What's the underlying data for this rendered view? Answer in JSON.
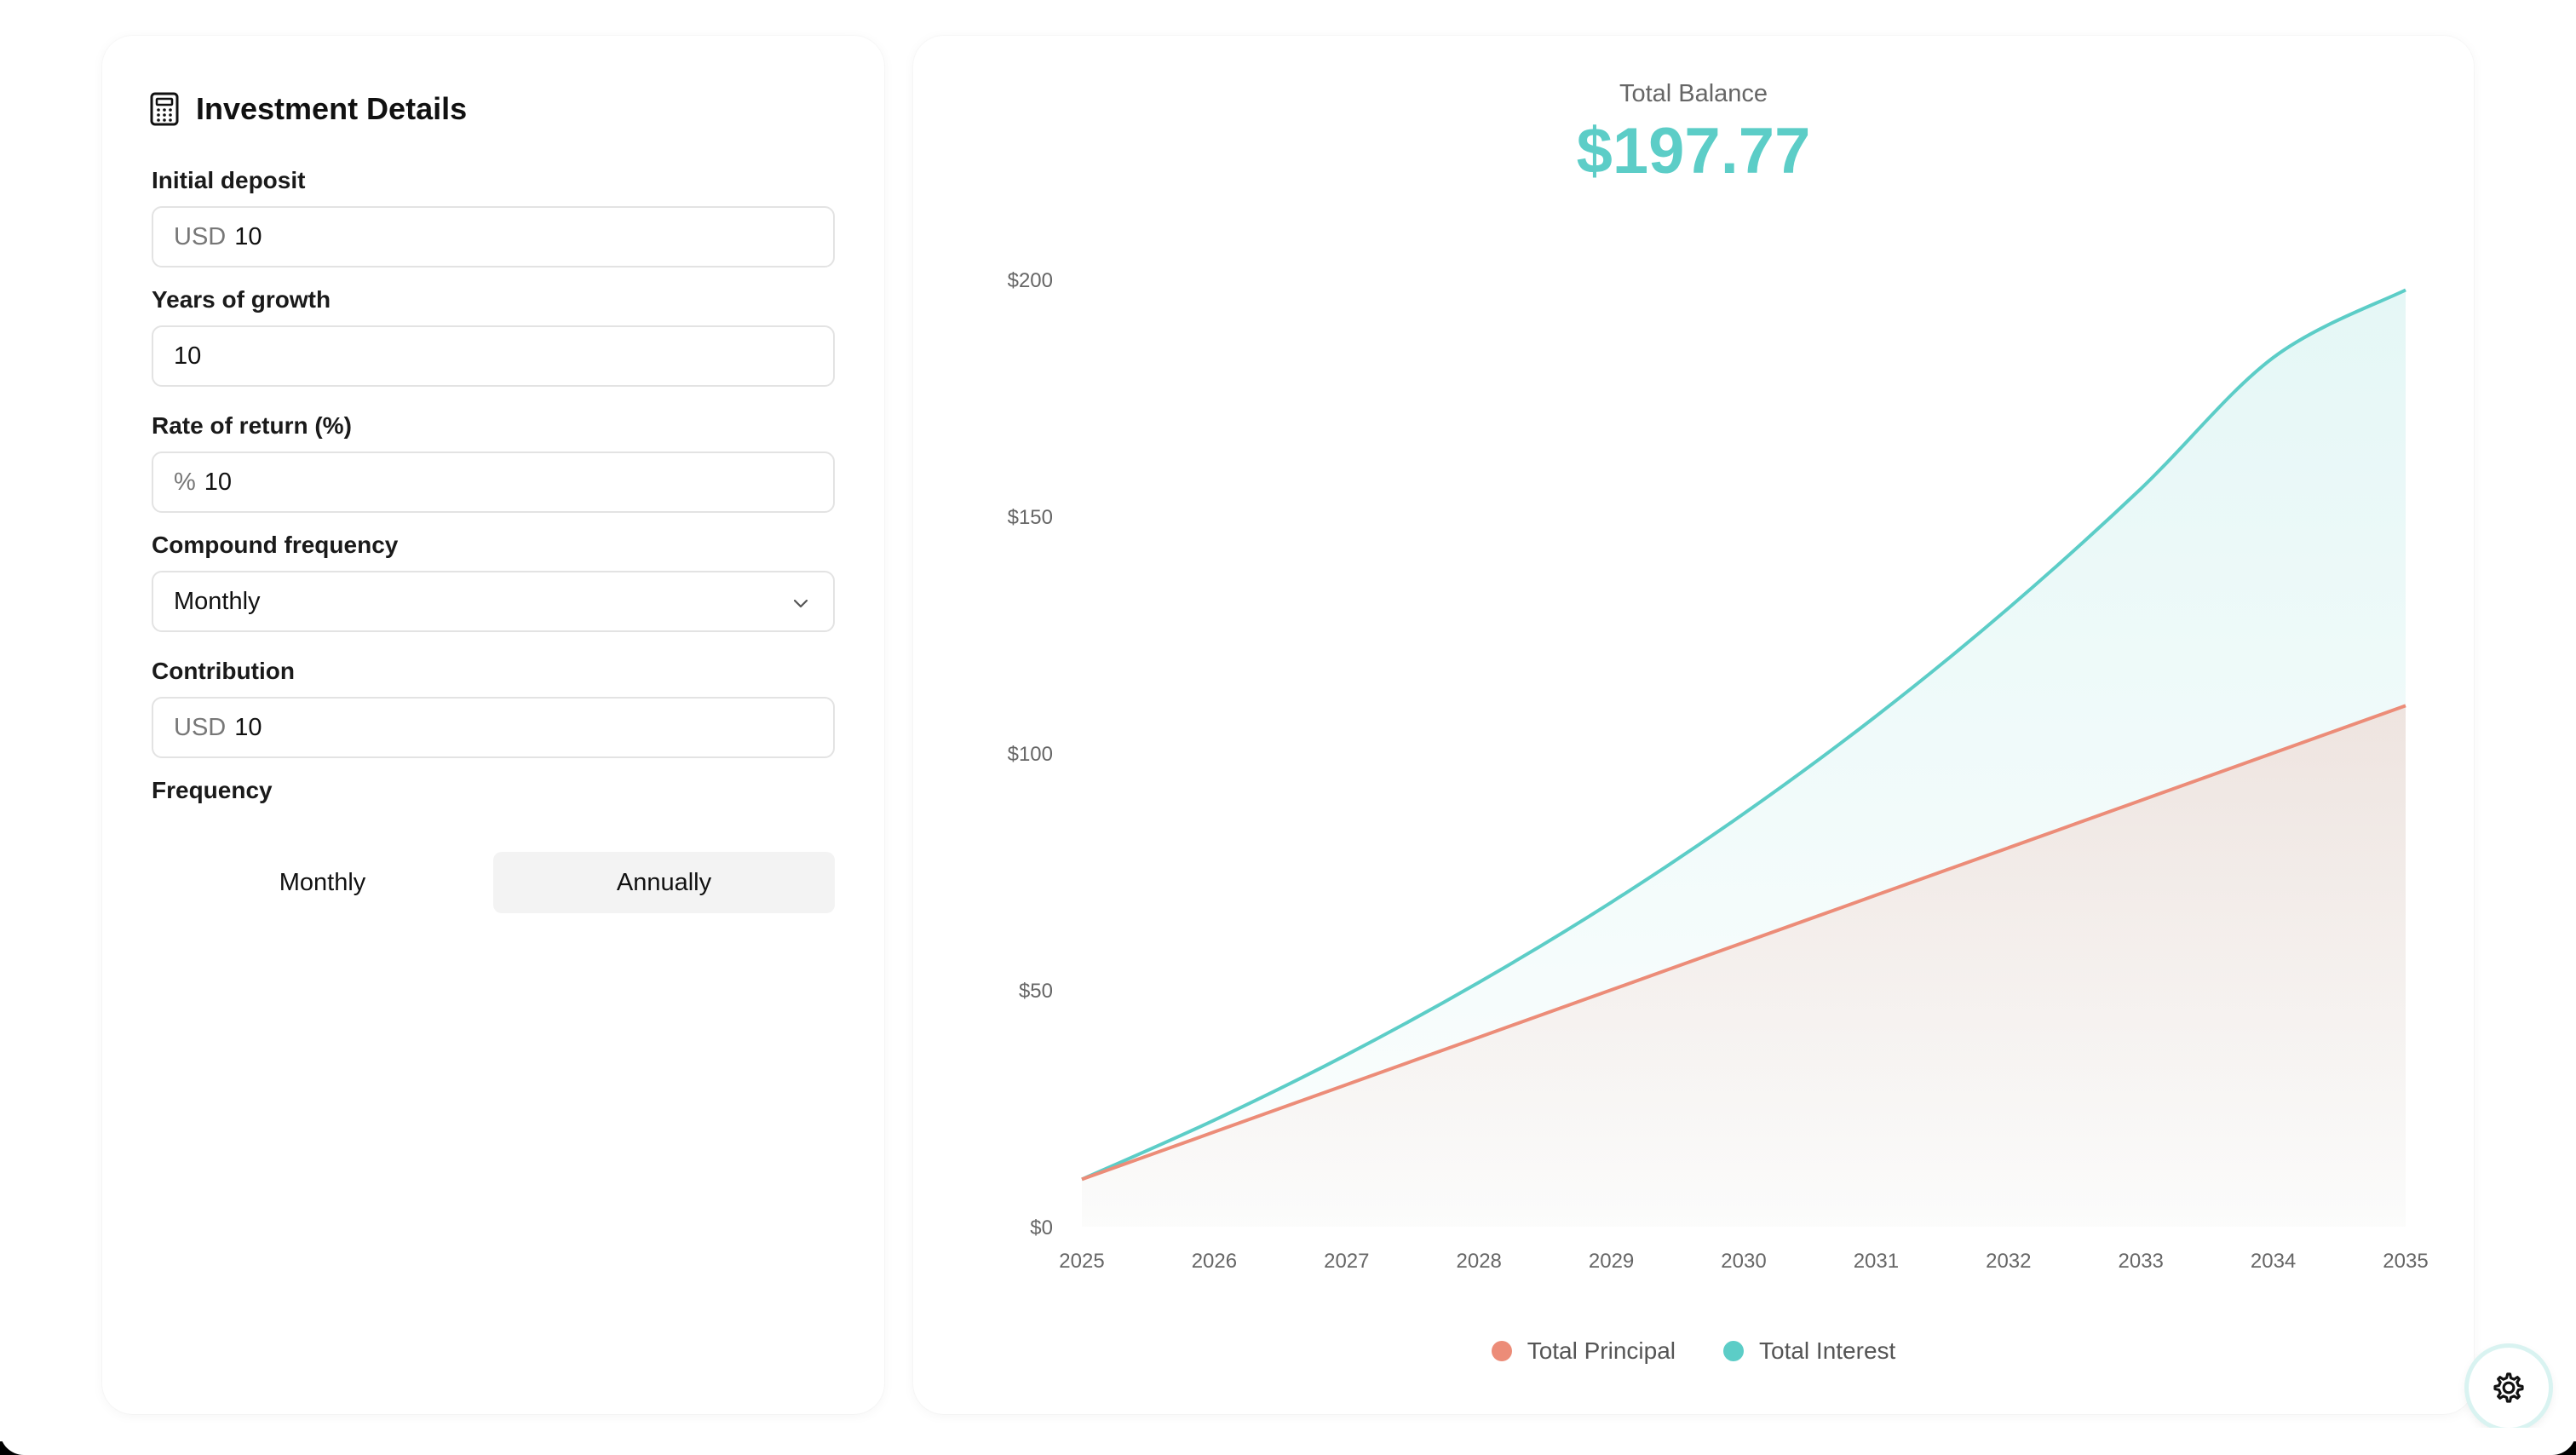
{
  "form": {
    "title": "Investment Details",
    "title_icon": "calculator-icon",
    "initial_deposit": {
      "label": "Initial deposit",
      "prefix": "USD",
      "value": "10"
    },
    "years": {
      "label": "Years of growth",
      "value": "10"
    },
    "rate": {
      "label": "Rate of return (%)",
      "prefix": "%",
      "value": "10"
    },
    "compound": {
      "label": "Compound frequency",
      "value": "Monthly",
      "icon": "chevron-down-icon"
    },
    "contribution": {
      "label": "Contribution",
      "prefix": "USD",
      "value": "10"
    },
    "frequency": {
      "label": "Frequency",
      "options": [
        "Monthly",
        "Annually"
      ],
      "selected": "Annually"
    }
  },
  "summary": {
    "label": "Total Balance",
    "value": "$197.77"
  },
  "colors": {
    "principal": "#ec8c78",
    "interest": "#5ccdc7"
  },
  "chart_data": {
    "type": "area",
    "x": [
      "2025",
      "2026",
      "2027",
      "2028",
      "2029",
      "2030",
      "2031",
      "2032",
      "2033",
      "2034",
      "2035"
    ],
    "yticks": [
      "$0",
      "$50",
      "$100",
      "$150",
      "$200"
    ],
    "ylim": [
      0,
      200
    ],
    "grid": false,
    "legend_position": "bottom-center",
    "series": [
      {
        "name": "Total Principal",
        "values": [
          10,
          20,
          30,
          40,
          50,
          60,
          70,
          80,
          90,
          100,
          110
        ]
      },
      {
        "name": "Total Interest",
        "values": [
          10,
          22.5,
          36.3,
          51.6,
          68.5,
          87.2,
          107.8,
          130.6,
          155.8,
          183.5,
          197.77
        ]
      }
    ]
  },
  "settings": {
    "icon": "gear-icon"
  }
}
